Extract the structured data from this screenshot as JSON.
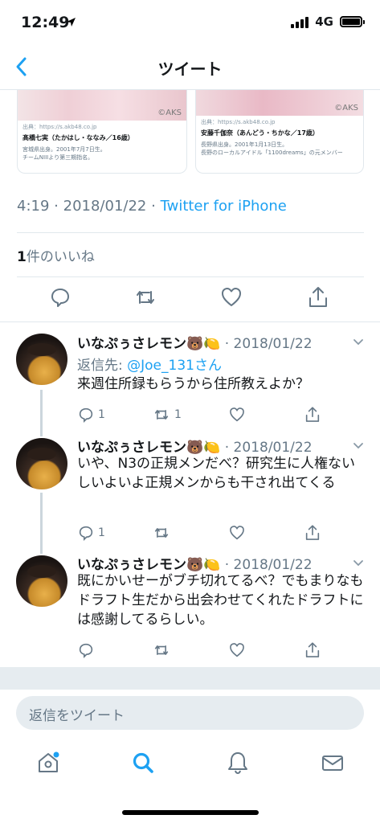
{
  "status_bar": {
    "time": "12:49",
    "network": "4G"
  },
  "header": {
    "title": "ツイート",
    "back_icon": "chevron-left-icon"
  },
  "link_cards": [
    {
      "source": "出典：https://s.akb48.co.jp",
      "name": "髙橋七実（たかはし・ななみ／16歳）",
      "desc1": "宮城県出身。2001年7月7日生。",
      "desc2": "チームNIIIより第三期指名。",
      "watermark": "©AKS"
    },
    {
      "source": "出典：https://s.akb48.co.jp",
      "name": "安藤千伽奈（あんどう・ちかな／17歳）",
      "desc1": "長野県出身。2001年1月13日生。",
      "desc2": "長野のローカルアイドル「1100dreams」の元メンバー",
      "watermark": "©AKS"
    }
  ],
  "tweet": {
    "time": "4:19",
    "dot": "·",
    "date": "2018/01/22",
    "via": "Twitter for iPhone",
    "like_count": "1",
    "like_label": "件のいいね"
  },
  "replies": [
    {
      "name": "いなぷぅさレモン🐻🍋",
      "date": "· 2018/01/22",
      "reply_to_label": "返信先: ",
      "reply_to_user": "@Joe_131さん",
      "text": "来週住所録もらうから住所教えよか？",
      "reply_count": "1",
      "retweet_count": "1"
    },
    {
      "name": "いなぷぅさレモン🐻🍋",
      "date": "· 2018/01/22",
      "text": "いや、N3の正規メンだべ？研究生に人権ないしいよいよ正規メンからも干され出てくる",
      "reply_count": "1"
    },
    {
      "name": "いなぷぅさレモン🐻🍋",
      "date": "· 2018/01/22",
      "text": "既にかいせーがブチ切れてるべ？でもまりなもドラフト生だから出会わせてくれたドラフトには感謝してるらしい。"
    }
  ],
  "reply_box": {
    "placeholder": "返信をツイート"
  },
  "tabs": [
    "home-icon",
    "search-icon",
    "notifications-icon",
    "messages-icon"
  ],
  "colors": {
    "accent": "#1da1f2",
    "muted": "#657786",
    "border": "#e1e8ed"
  }
}
